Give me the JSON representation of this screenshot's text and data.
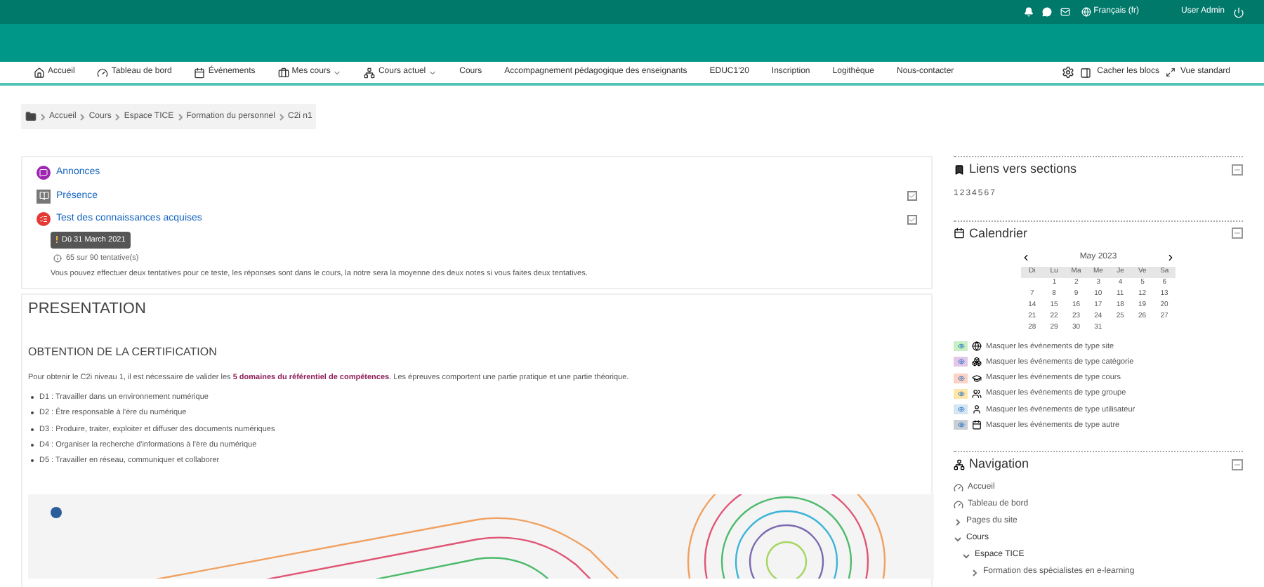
{
  "top_bar": {
    "language": "Français (fr)",
    "user": "User Admin"
  },
  "nav": {
    "items": [
      {
        "label": "Accueil",
        "dropdown": false
      },
      {
        "label": "Tableau de bord",
        "dropdown": false
      },
      {
        "label": "Événements",
        "dropdown": false
      },
      {
        "label": "Mes cours",
        "dropdown": true
      },
      {
        "label": "Cours actuel",
        "dropdown": true
      },
      {
        "label": "Cours",
        "dropdown": false
      },
      {
        "label": "Accompagnement pédagogique des enseignants",
        "dropdown": false
      },
      {
        "label": "EDUC1'20",
        "dropdown": false
      },
      {
        "label": "Inscription",
        "dropdown": false
      },
      {
        "label": "Logithèque",
        "dropdown": false
      },
      {
        "label": "Nous-contacter",
        "dropdown": false
      }
    ],
    "hide_blocks": "Cacher les blocs",
    "standard_view": "Vue standard"
  },
  "breadcrumb": [
    "Accueil",
    "Cours",
    "Espace TICE",
    "Formation du personnel",
    "C2i n1"
  ],
  "activities": [
    {
      "kind": "forum",
      "name": "Annonces",
      "completion": false
    },
    {
      "kind": "attendance",
      "name": "Présence",
      "completion": true
    },
    {
      "kind": "quiz",
      "name": "Test des connaissances acquises",
      "completion": true,
      "due": "Dû 31 March 2021",
      "attempts": "65 sur 90 tentative(s)",
      "description": "Vous pouvez effectuer deux tentatives pour ce teste, les réponses sont dans le cours, la notre sera la moyenne des deux notes si vous faites deux tentatives."
    }
  ],
  "section": {
    "title": "PRESENTATION",
    "subtitle": "OBTENTION DE LA CERTIFICATION",
    "intro": "Pour obtenir le C2i niveau 1, il est nécessaire de valider les **5 domaines du référentiel de compétences**. Les épreuves comportent une partie pratique et une partie théorique.",
    "domains": [
      "D1 : Travailler dans un environnement numérique",
      "D2 : Être responsable à l'ère du numérique",
      "D3 : Produire, traiter, exploiter et diffuser des documents numériques",
      "D4 : Organiser la recherche d'informations à l'ère du numérique",
      "D5 : Travailler en réseau, communiquer et collaborer"
    ]
  },
  "sections_block": {
    "title": "Liens vers sections",
    "links": [
      "1",
      "2",
      "3",
      "4",
      "5",
      "6",
      "7"
    ]
  },
  "calendar": {
    "title": "Calendrier",
    "month": "May 2023",
    "weekdays": [
      "Di",
      "Lu",
      "Ma",
      "Me",
      "Je",
      "Ve",
      "Sa"
    ],
    "weeks": [
      [
        "1",
        "2",
        "3",
        "4",
        "5",
        "6"
      ],
      [
        "7",
        "8",
        "9",
        "10",
        "11",
        "12",
        "13"
      ],
      [
        "14",
        "15",
        "16",
        "17",
        "18",
        "19",
        "20"
      ],
      [
        "21",
        "22",
        "23",
        "24",
        "25",
        "26",
        "27"
      ],
      [
        "28",
        "29",
        "30",
        "31"
      ]
    ],
    "filters": [
      {
        "label": "Masquer les événements de type site",
        "color": "#c9f0c4"
      },
      {
        "label": "Masquer les événements de type catégorie",
        "color": "#e3c7e8"
      },
      {
        "label": "Masquer les événements de type cours",
        "color": "#fbd2c3"
      },
      {
        "label": "Masquer les événements de type groupe",
        "color": "#fde6a8"
      },
      {
        "label": "Masquer les événements de type utilisateur",
        "color": "#d5e6f2"
      },
      {
        "label": "Masquer les événements de type autre",
        "color": "#c9ced6"
      }
    ]
  },
  "navigation": {
    "title": "Navigation",
    "items": [
      {
        "label": "Accueil",
        "kind": "link"
      },
      {
        "label": "Tableau de bord",
        "kind": "link"
      },
      {
        "label": "Pages du site",
        "kind": "branch",
        "expanded": false
      },
      {
        "label": "Cours",
        "kind": "branch",
        "expanded": true,
        "children": [
          {
            "label": "Espace TICE",
            "kind": "branch",
            "expanded": true,
            "children": [
              {
                "label": "Formation des spécialistes en e-learning",
                "kind": "branch",
                "expanded": false
              }
            ]
          }
        ]
      }
    ]
  }
}
